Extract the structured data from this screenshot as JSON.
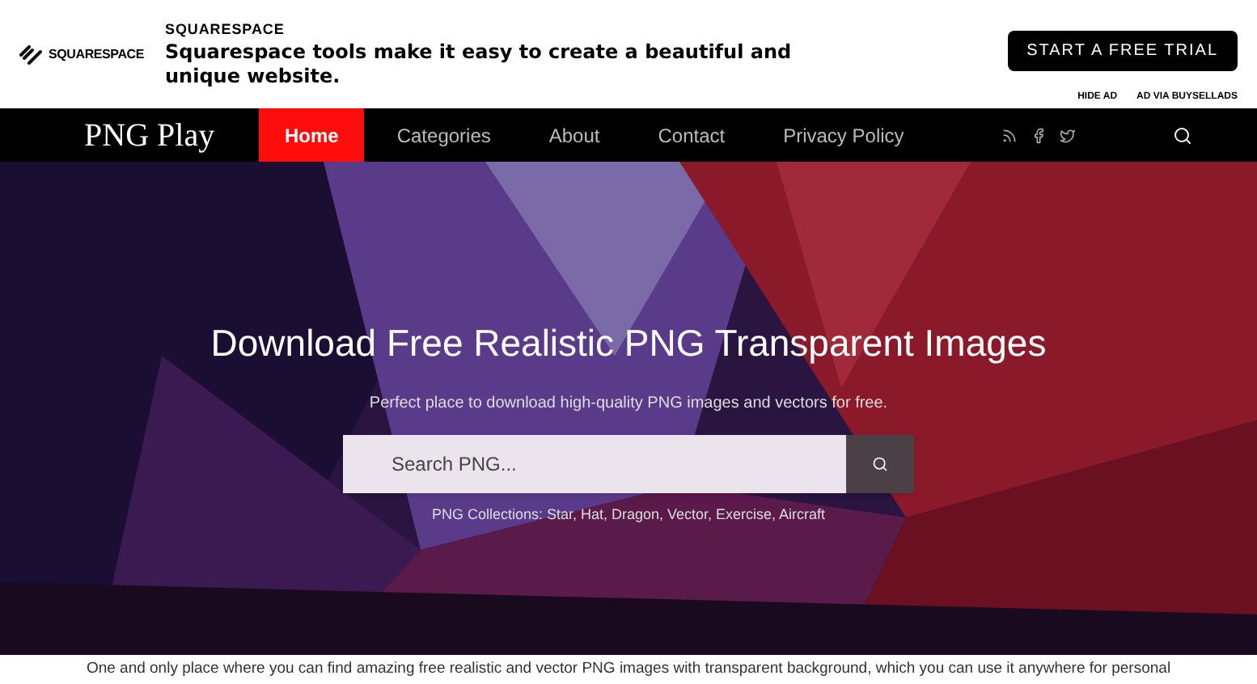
{
  "ad": {
    "logo": "SQUARESPACE",
    "title": "SQUARESPACE",
    "text": "Squarespace tools make it easy to create a beautiful and unique website.",
    "cta": "START A FREE TRIAL",
    "links": [
      "HIDE AD",
      "AD VIA BUYSELLADS"
    ]
  },
  "nav": {
    "brand": "PNG Play",
    "items": [
      {
        "label": "Home",
        "selected": true
      },
      {
        "label": "Categories",
        "selected": false
      },
      {
        "label": "About",
        "selected": false
      },
      {
        "label": "Contact",
        "selected": false
      },
      {
        "label": "Privacy Policy",
        "selected": false
      }
    ]
  },
  "hero": {
    "title": "Download Free Realistic PNG Transparent Images",
    "subtitle": "Perfect place to download high-quality PNG images and vectors for free.",
    "search": {
      "placeholder": "Search PNG..."
    },
    "collections": "PNG Collections: Star, Hat, Dragon, Vector, Exercise, Aircraft"
  },
  "intro": "One and only place where you can find amazing free realistic and vector PNG images with transparent background, which you can use it anywhere for personal"
}
